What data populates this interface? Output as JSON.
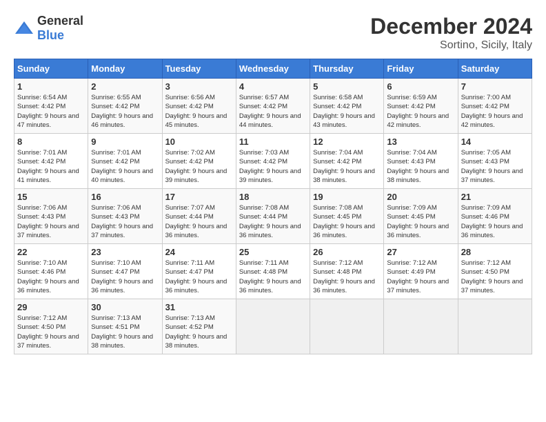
{
  "logo": {
    "text_general": "General",
    "text_blue": "Blue"
  },
  "header": {
    "title": "December 2024",
    "subtitle": "Sortino, Sicily, Italy"
  },
  "weekdays": [
    "Sunday",
    "Monday",
    "Tuesday",
    "Wednesday",
    "Thursday",
    "Friday",
    "Saturday"
  ],
  "weeks": [
    [
      {
        "day": "1",
        "sunrise": "Sunrise: 6:54 AM",
        "sunset": "Sunset: 4:42 PM",
        "daylight": "Daylight: 9 hours and 47 minutes."
      },
      {
        "day": "2",
        "sunrise": "Sunrise: 6:55 AM",
        "sunset": "Sunset: 4:42 PM",
        "daylight": "Daylight: 9 hours and 46 minutes."
      },
      {
        "day": "3",
        "sunrise": "Sunrise: 6:56 AM",
        "sunset": "Sunset: 4:42 PM",
        "daylight": "Daylight: 9 hours and 45 minutes."
      },
      {
        "day": "4",
        "sunrise": "Sunrise: 6:57 AM",
        "sunset": "Sunset: 4:42 PM",
        "daylight": "Daylight: 9 hours and 44 minutes."
      },
      {
        "day": "5",
        "sunrise": "Sunrise: 6:58 AM",
        "sunset": "Sunset: 4:42 PM",
        "daylight": "Daylight: 9 hours and 43 minutes."
      },
      {
        "day": "6",
        "sunrise": "Sunrise: 6:59 AM",
        "sunset": "Sunset: 4:42 PM",
        "daylight": "Daylight: 9 hours and 42 minutes."
      },
      {
        "day": "7",
        "sunrise": "Sunrise: 7:00 AM",
        "sunset": "Sunset: 4:42 PM",
        "daylight": "Daylight: 9 hours and 42 minutes."
      }
    ],
    [
      {
        "day": "8",
        "sunrise": "Sunrise: 7:01 AM",
        "sunset": "Sunset: 4:42 PM",
        "daylight": "Daylight: 9 hours and 41 minutes."
      },
      {
        "day": "9",
        "sunrise": "Sunrise: 7:01 AM",
        "sunset": "Sunset: 4:42 PM",
        "daylight": "Daylight: 9 hours and 40 minutes."
      },
      {
        "day": "10",
        "sunrise": "Sunrise: 7:02 AM",
        "sunset": "Sunset: 4:42 PM",
        "daylight": "Daylight: 9 hours and 39 minutes."
      },
      {
        "day": "11",
        "sunrise": "Sunrise: 7:03 AM",
        "sunset": "Sunset: 4:42 PM",
        "daylight": "Daylight: 9 hours and 39 minutes."
      },
      {
        "day": "12",
        "sunrise": "Sunrise: 7:04 AM",
        "sunset": "Sunset: 4:42 PM",
        "daylight": "Daylight: 9 hours and 38 minutes."
      },
      {
        "day": "13",
        "sunrise": "Sunrise: 7:04 AM",
        "sunset": "Sunset: 4:43 PM",
        "daylight": "Daylight: 9 hours and 38 minutes."
      },
      {
        "day": "14",
        "sunrise": "Sunrise: 7:05 AM",
        "sunset": "Sunset: 4:43 PM",
        "daylight": "Daylight: 9 hours and 37 minutes."
      }
    ],
    [
      {
        "day": "15",
        "sunrise": "Sunrise: 7:06 AM",
        "sunset": "Sunset: 4:43 PM",
        "daylight": "Daylight: 9 hours and 37 minutes."
      },
      {
        "day": "16",
        "sunrise": "Sunrise: 7:06 AM",
        "sunset": "Sunset: 4:43 PM",
        "daylight": "Daylight: 9 hours and 37 minutes."
      },
      {
        "day": "17",
        "sunrise": "Sunrise: 7:07 AM",
        "sunset": "Sunset: 4:44 PM",
        "daylight": "Daylight: 9 hours and 36 minutes."
      },
      {
        "day": "18",
        "sunrise": "Sunrise: 7:08 AM",
        "sunset": "Sunset: 4:44 PM",
        "daylight": "Daylight: 9 hours and 36 minutes."
      },
      {
        "day": "19",
        "sunrise": "Sunrise: 7:08 AM",
        "sunset": "Sunset: 4:45 PM",
        "daylight": "Daylight: 9 hours and 36 minutes."
      },
      {
        "day": "20",
        "sunrise": "Sunrise: 7:09 AM",
        "sunset": "Sunset: 4:45 PM",
        "daylight": "Daylight: 9 hours and 36 minutes."
      },
      {
        "day": "21",
        "sunrise": "Sunrise: 7:09 AM",
        "sunset": "Sunset: 4:46 PM",
        "daylight": "Daylight: 9 hours and 36 minutes."
      }
    ],
    [
      {
        "day": "22",
        "sunrise": "Sunrise: 7:10 AM",
        "sunset": "Sunset: 4:46 PM",
        "daylight": "Daylight: 9 hours and 36 minutes."
      },
      {
        "day": "23",
        "sunrise": "Sunrise: 7:10 AM",
        "sunset": "Sunset: 4:47 PM",
        "daylight": "Daylight: 9 hours and 36 minutes."
      },
      {
        "day": "24",
        "sunrise": "Sunrise: 7:11 AM",
        "sunset": "Sunset: 4:47 PM",
        "daylight": "Daylight: 9 hours and 36 minutes."
      },
      {
        "day": "25",
        "sunrise": "Sunrise: 7:11 AM",
        "sunset": "Sunset: 4:48 PM",
        "daylight": "Daylight: 9 hours and 36 minutes."
      },
      {
        "day": "26",
        "sunrise": "Sunrise: 7:12 AM",
        "sunset": "Sunset: 4:48 PM",
        "daylight": "Daylight: 9 hours and 36 minutes."
      },
      {
        "day": "27",
        "sunrise": "Sunrise: 7:12 AM",
        "sunset": "Sunset: 4:49 PM",
        "daylight": "Daylight: 9 hours and 37 minutes."
      },
      {
        "day": "28",
        "sunrise": "Sunrise: 7:12 AM",
        "sunset": "Sunset: 4:50 PM",
        "daylight": "Daylight: 9 hours and 37 minutes."
      }
    ],
    [
      {
        "day": "29",
        "sunrise": "Sunrise: 7:12 AM",
        "sunset": "Sunset: 4:50 PM",
        "daylight": "Daylight: 9 hours and 37 minutes."
      },
      {
        "day": "30",
        "sunrise": "Sunrise: 7:13 AM",
        "sunset": "Sunset: 4:51 PM",
        "daylight": "Daylight: 9 hours and 38 minutes."
      },
      {
        "day": "31",
        "sunrise": "Sunrise: 7:13 AM",
        "sunset": "Sunset: 4:52 PM",
        "daylight": "Daylight: 9 hours and 38 minutes."
      },
      null,
      null,
      null,
      null
    ]
  ]
}
